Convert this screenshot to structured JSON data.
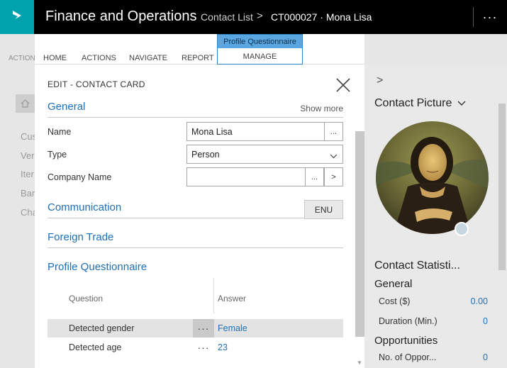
{
  "header": {
    "app_title": "Finance and Operations",
    "breadcrumb_page": "Contact List",
    "breadcrumb_separator": ">",
    "breadcrumb_record": "CT000027 · Mona Lisa",
    "more": "···"
  },
  "background": {
    "action_label": "ACTION",
    "nav_items": [
      "Cus",
      "Ver",
      "Iter",
      "Bar",
      "Cha"
    ]
  },
  "ribbon": {
    "tabs": [
      "HOME",
      "ACTIONS",
      "NAVIGATE",
      "REPORT"
    ],
    "contextual_group": "Profile Questionnaire",
    "contextual_tab": "MANAGE"
  },
  "dialog": {
    "title": "EDIT - CONTACT CARD",
    "general": {
      "title": "General",
      "show_more": "Show more",
      "name_label": "Name",
      "name_value": "Mona Lisa",
      "type_label": "Type",
      "type_value": "Person",
      "company_label": "Company Name",
      "company_value": "",
      "lookup_button": "...",
      "open_button": ">"
    },
    "communication": {
      "title": "Communication",
      "language": "ENU"
    },
    "foreign_trade": {
      "title": "Foreign Trade"
    },
    "profile": {
      "title": "Profile Questionnaire",
      "col_question": "Question",
      "col_answer": "Answer",
      "rows": [
        {
          "question": "Detected gender",
          "answer": "Female",
          "dots": "···"
        },
        {
          "question": "Detected age",
          "answer": "23",
          "dots": "···"
        }
      ]
    }
  },
  "factbox": {
    "chevron": ">",
    "picture_title": "Contact Picture",
    "stats_title": "Contact Statisti...",
    "general_title": "General",
    "cost_label": "Cost ($)",
    "cost_value": "0.00",
    "duration_label": "Duration (Min.)",
    "duration_value": "0",
    "opps_title": "Opportunities",
    "opps_label": "No. of Oppor...",
    "opps_value": "0"
  },
  "colors": {
    "accent": "#1f6fb4",
    "brand_tile": "#00a2ad",
    "topbar": "#000000",
    "ribbon_highlight": "#5aa6e0"
  }
}
